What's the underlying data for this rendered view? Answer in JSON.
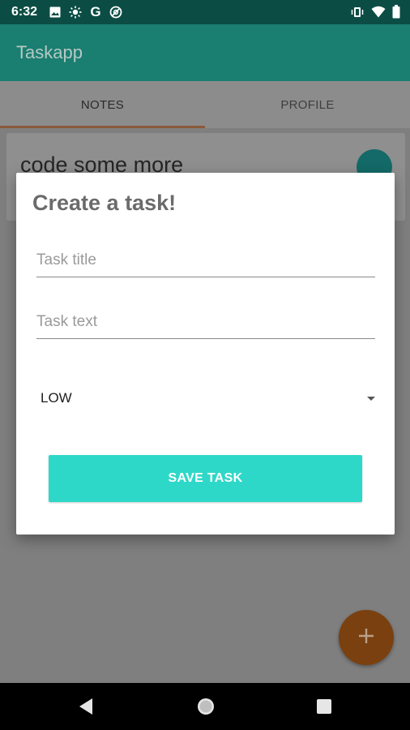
{
  "status_bar": {
    "time": "6:32",
    "icon_g": "G"
  },
  "app_bar": {
    "title": "Taskapp"
  },
  "tabs": [
    {
      "label": "NOTES"
    },
    {
      "label": "PROFILE"
    }
  ],
  "note_card": {
    "title": "code some more"
  },
  "dialog": {
    "title": "Create a task!",
    "task_title_placeholder": "Task title",
    "task_text_placeholder": "Task text",
    "priority": "LOW",
    "save_label": "SAVE TASK"
  },
  "colors": {
    "status_bar": "#0b4d45",
    "app_bar": "#1a7e70",
    "accent": "#2ed8c8",
    "fab": "#7b400f",
    "dialog_title": "#6b6b6b"
  },
  "icons": {
    "status_left": [
      "image-icon",
      "brightness-icon",
      "google-icon",
      "at-sign-icon"
    ],
    "status_right": [
      "vibrate-icon",
      "wifi-icon",
      "battery-icon"
    ],
    "nav": [
      "back-icon",
      "home-icon",
      "recents-icon"
    ],
    "fab": "plus-icon",
    "dropdown": "chevron-down-icon"
  }
}
